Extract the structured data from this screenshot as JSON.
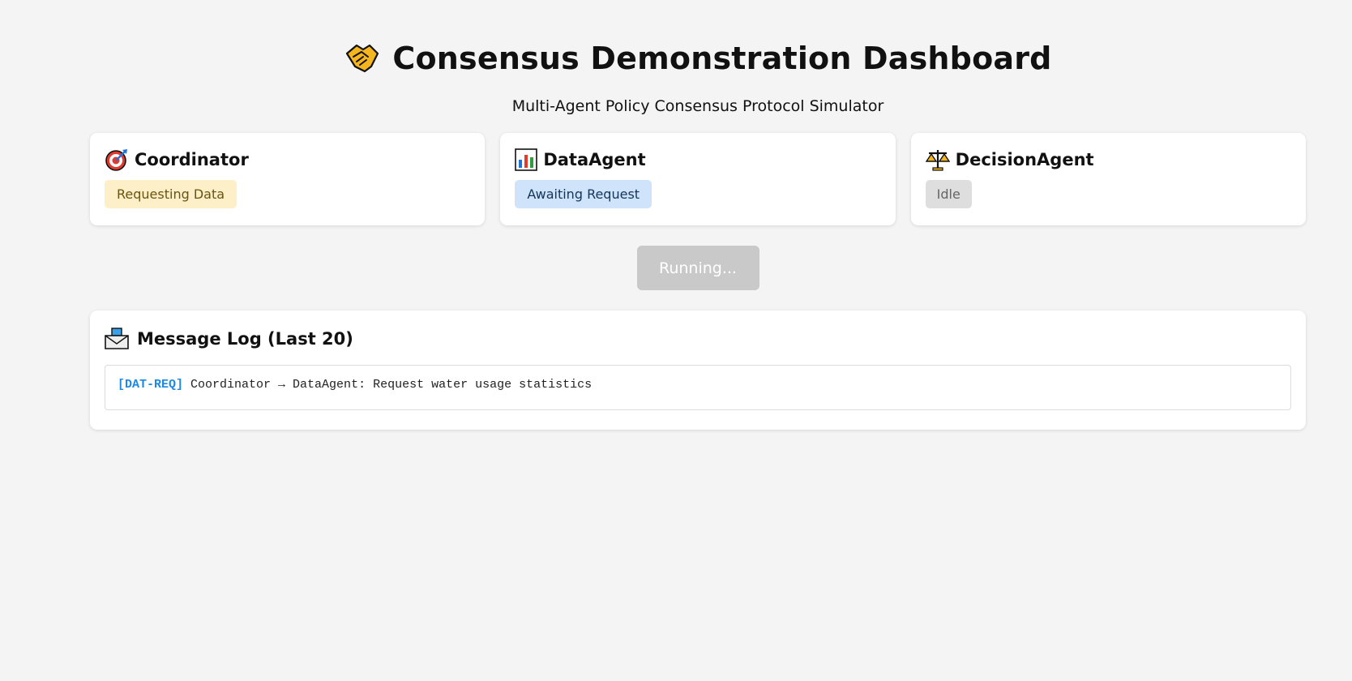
{
  "header": {
    "icon": "handshake-icon",
    "title": "Consensus Demonstration Dashboard",
    "subtitle": "Multi-Agent Policy Consensus Protocol Simulator"
  },
  "agents": [
    {
      "name": "Coordinator",
      "icon": "target-icon",
      "status": "Requesting Data",
      "status_color": "#fdf0c8"
    },
    {
      "name": "DataAgent",
      "icon": "bar-chart-icon",
      "status": "Awaiting Request",
      "status_color": "#cfe4fb"
    },
    {
      "name": "DecisionAgent",
      "icon": "scales-icon",
      "status": "Idle",
      "status_color": "#dedede"
    }
  ],
  "controls": {
    "run_label": "Running..."
  },
  "log": {
    "icon": "inbox-tray-icon",
    "title": "Message Log (Last 20)",
    "entries": [
      {
        "tag": "[DAT-REQ]",
        "text": "Coordinator → DataAgent: Request water usage statistics"
      }
    ]
  }
}
